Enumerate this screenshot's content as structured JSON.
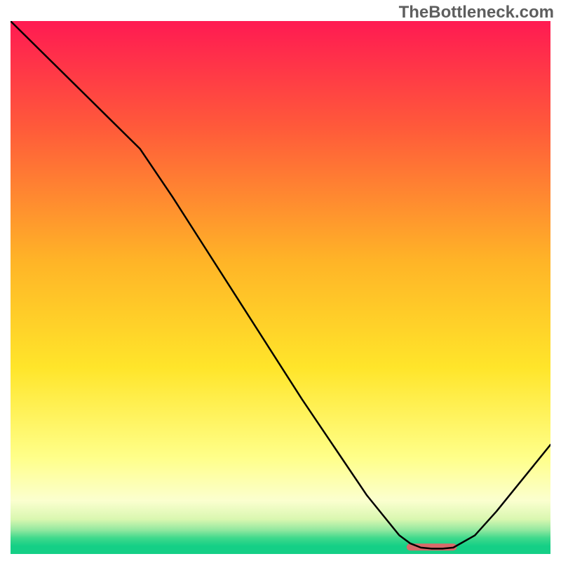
{
  "watermark": "TheBottleneck.com",
  "chart_data": {
    "type": "line",
    "title": "",
    "xlabel": "",
    "ylabel": "",
    "xlim": [
      0,
      100
    ],
    "ylim": [
      0,
      100
    ],
    "grid": false,
    "legend": false,
    "background": {
      "type": "vertical-gradient",
      "stops": [
        {
          "offset": 0.0,
          "color": "#ff1a52"
        },
        {
          "offset": 0.2,
          "color": "#ff5a3a"
        },
        {
          "offset": 0.45,
          "color": "#ffb427"
        },
        {
          "offset": 0.65,
          "color": "#ffe52a"
        },
        {
          "offset": 0.82,
          "color": "#ffff8a"
        },
        {
          "offset": 0.9,
          "color": "#fbffcf"
        },
        {
          "offset": 0.935,
          "color": "#d9f7b0"
        },
        {
          "offset": 0.955,
          "color": "#92e8a0"
        },
        {
          "offset": 0.97,
          "color": "#3fd98c"
        },
        {
          "offset": 0.985,
          "color": "#15cf86"
        },
        {
          "offset": 1.0,
          "color": "#15cf86"
        }
      ]
    },
    "series": [
      {
        "name": "bottleneck-curve",
        "color": "#000000",
        "width": 2.5,
        "x": [
          0,
          6,
          12,
          18,
          24,
          30,
          36,
          42,
          48,
          54,
          60,
          66,
          72,
          74,
          76,
          78,
          80,
          82,
          86,
          90,
          94,
          98,
          100
        ],
        "y": [
          100,
          94,
          88,
          82,
          76,
          67,
          57.5,
          48,
          38.5,
          29,
          20,
          11,
          3.5,
          2,
          1.2,
          1,
          1,
          1.2,
          3.5,
          8,
          13,
          18,
          20.5
        ]
      }
    ],
    "annotations": [
      {
        "name": "min-band",
        "type": "segment",
        "x0": 74,
        "x1": 82,
        "y": 1.3,
        "color": "#d86a6a",
        "thickness": 10
      }
    ]
  }
}
